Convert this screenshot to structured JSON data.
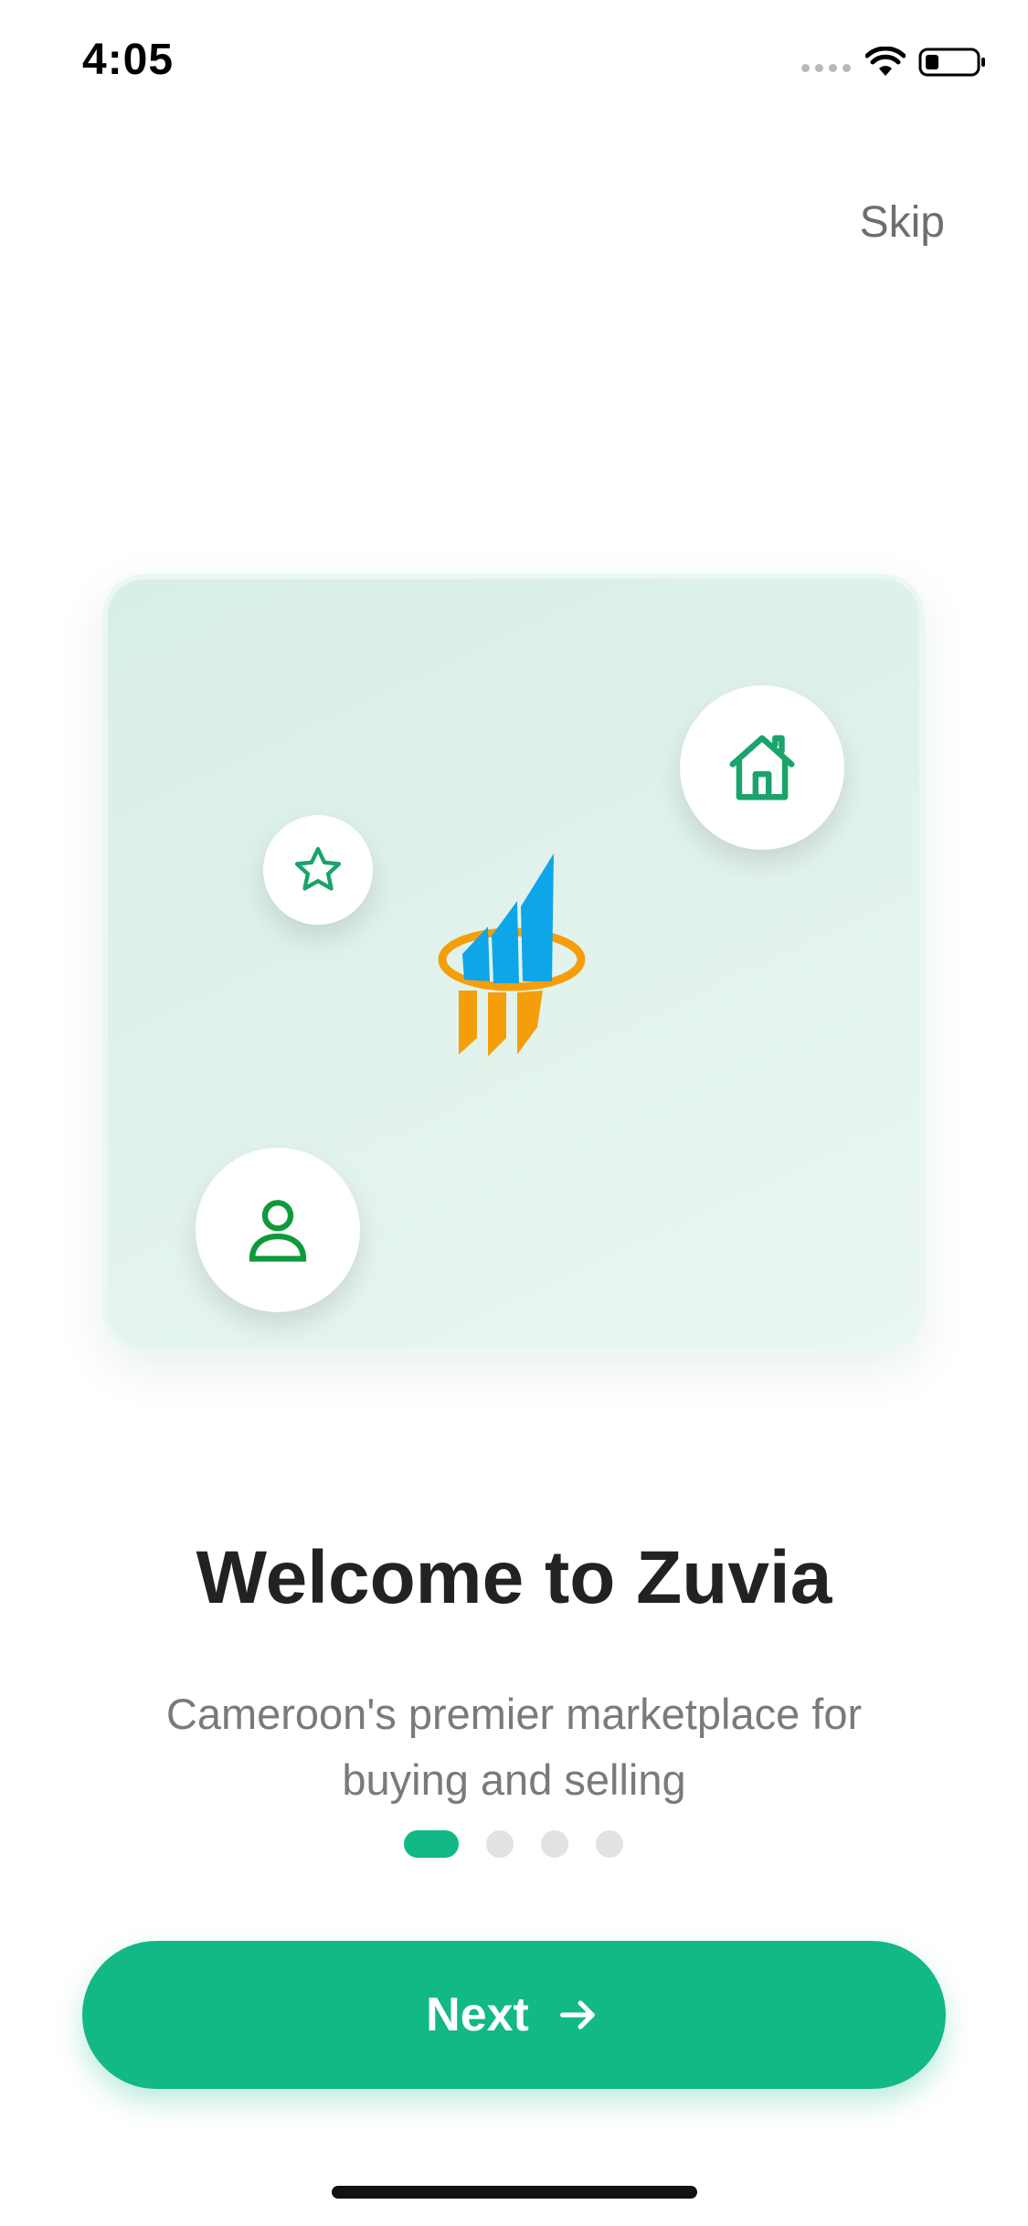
{
  "status_bar": {
    "time": "4:05",
    "icons": [
      "cellular-signal-icon",
      "wifi-icon",
      "battery-icon"
    ]
  },
  "header": {
    "skip_label": "Skip"
  },
  "hero": {
    "icons": [
      "house-icon",
      "star-icon",
      "user-icon",
      "zuvia-logo"
    ]
  },
  "content": {
    "title": "Welcome to Zuvia",
    "subtitle": "Cameroon's premier marketplace for buying and selling"
  },
  "pagination": {
    "total": 4,
    "current": 1
  },
  "next_button": {
    "label": "Next",
    "icon": "arrow-right-icon"
  },
  "colors": {
    "accent": "#12b886",
    "icon_green": "#1aa36b",
    "logo_blue": "#0ea5e9",
    "logo_orange": "#f59e0b",
    "hero_bg": "#deefe8"
  }
}
